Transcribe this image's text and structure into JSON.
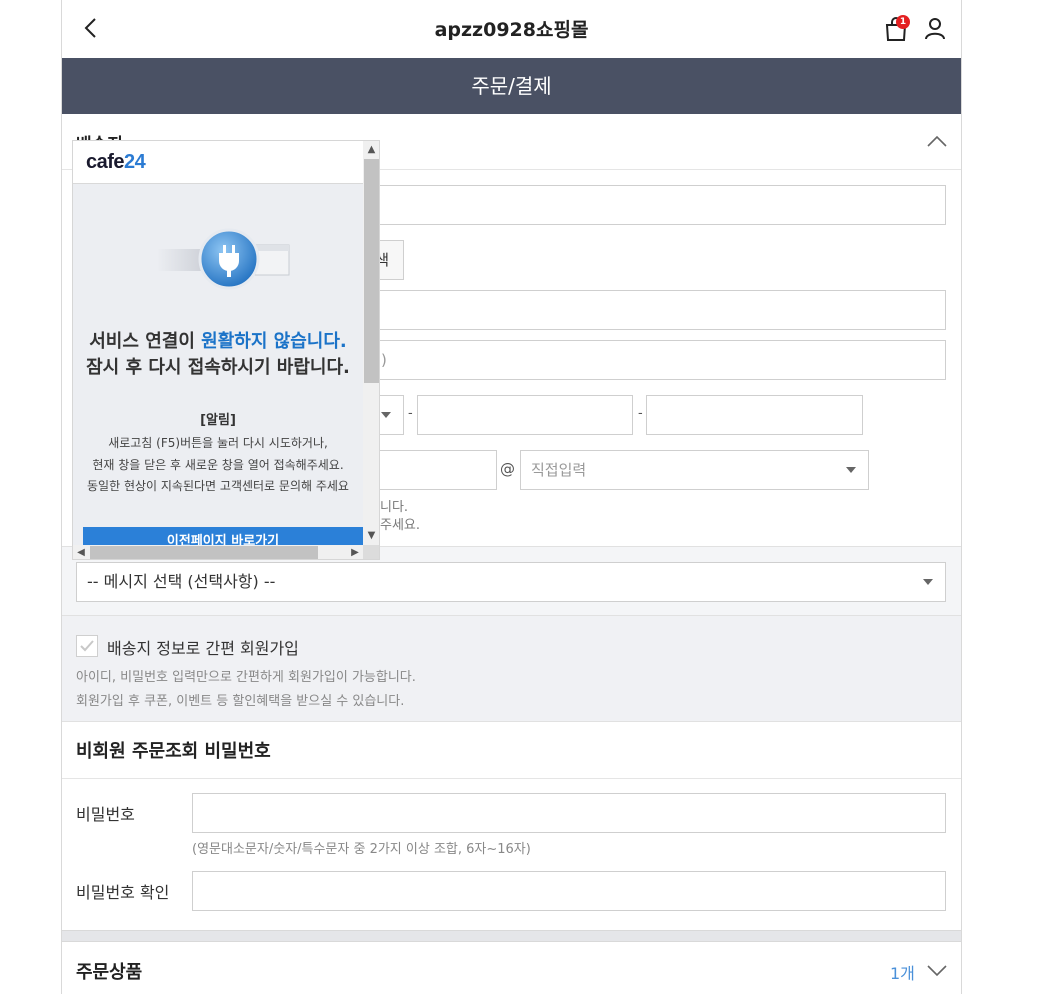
{
  "header": {
    "shop_name": "apzz0928쇼핑몰",
    "cart_count": "1",
    "page_title": "주문/결제"
  },
  "shipping": {
    "section_label": "배송지",
    "partial_button": "색",
    "partial_address_text": ")",
    "email_domain_placeholder": "직접입력",
    "hint_partial_1": "니다.",
    "hint_partial_2": "주세요."
  },
  "message": {
    "select_value": "-- 메시지 선택 (선택사항) --"
  },
  "join": {
    "label": "배송지 정보로 간편 회원가입",
    "desc1": "아이디, 비밀번호 입력만으로 간편하게 회원가입이 가능합니다.",
    "desc2": "회원가입 후 쿠폰, 이벤트 등 할인혜택을 받으실 수 있습니다."
  },
  "password": {
    "section_title": "비회원 주문조회 비밀번호",
    "pw_label": "비밀번호",
    "pw_hint": "(영문대소문자/숫자/특수문자 중 2가지 이상 조합, 6자~16자)",
    "pw_confirm_label": "비밀번호 확인"
  },
  "order": {
    "section_title": "주문상품",
    "count": "1개"
  },
  "popup": {
    "logo_main": "cafe",
    "logo_num": "24",
    "msg1_prefix": "서비스 연결이 ",
    "msg1_highlight": "원활하지 않습니다.",
    "msg2": "잠시 후 다시 접속하시기 바랍니다.",
    "notice_title": "[알림]",
    "line1": "새로고침 (F5)버튼을 눌러 다시 시도하거나,",
    "line2": "현재 창을 닫은 후 새로운 창을 열어 접속해주세요.",
    "line3": "동일한 현상이 지속된다면 고객센터로 문의해 주세요",
    "button_label": "이전페이지 바로가기"
  },
  "colors": {
    "title_bar": "#4a5164",
    "badge": "#e42021",
    "accent_blue": "#2b80d8"
  }
}
